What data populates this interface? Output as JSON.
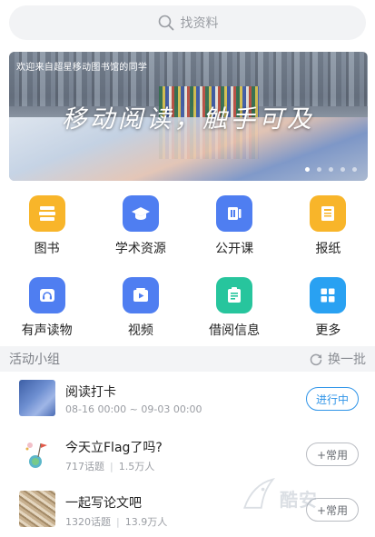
{
  "search": {
    "placeholder": "找资料",
    "icon": "search-icon"
  },
  "banner": {
    "welcome": "欢迎来自超星移动图书馆的同学",
    "slogan": "移动阅读，触手可及",
    "dot_count": 5,
    "active_dot": 0
  },
  "menu": [
    {
      "label": "图书",
      "icon": "books-icon",
      "color": "#f8b52a"
    },
    {
      "label": "学术资源",
      "icon": "graduation-cap-icon",
      "color": "#4f7ef1"
    },
    {
      "label": "公开课",
      "icon": "open-course-icon",
      "color": "#4f7ef1"
    },
    {
      "label": "报纸",
      "icon": "newspaper-icon",
      "color": "#f8b52a"
    },
    {
      "label": "有声读物",
      "icon": "headphones-icon",
      "color": "#4f7ef1"
    },
    {
      "label": "视频",
      "icon": "video-play-icon",
      "color": "#4f7ef1"
    },
    {
      "label": "借阅信息",
      "icon": "clipboard-icon",
      "color": "#27c59d"
    },
    {
      "label": "更多",
      "icon": "grid-more-icon",
      "color": "#29a1f2"
    }
  ],
  "activity": {
    "title": "活动小组",
    "refresh_label": "换一批",
    "groups": [
      {
        "name": "阅读打卡",
        "meta_a": "08-16 00:00 ~ 09-03 00:00",
        "meta_b": "",
        "button": "进行中",
        "button_style": "active"
      },
      {
        "name": "今天立Flag了吗?",
        "meta_a": "717话题",
        "meta_b": "1.5万人",
        "button": "+常用",
        "button_style": "normal"
      },
      {
        "name": "一起写论文吧",
        "meta_a": "1320话题",
        "meta_b": "13.9万人",
        "button": "+常用",
        "button_style": "normal"
      }
    ]
  },
  "watermark": {
    "text": "酷安"
  },
  "colors": {
    "accent": "#2f94e8",
    "yellow": "#f8b52a",
    "blue": "#4f7ef1",
    "green": "#27c59d"
  }
}
